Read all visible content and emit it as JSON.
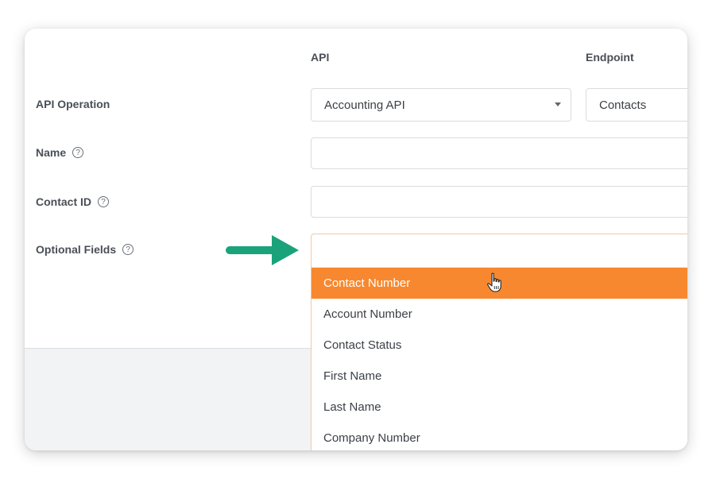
{
  "columns": {
    "api": "API",
    "endpoint": "Endpoint"
  },
  "rows": {
    "api_operation": {
      "label": "API Operation",
      "api_value": "Accounting API",
      "endpoint_value": "Contacts"
    },
    "name": {
      "label": "Name",
      "value": ""
    },
    "contact_id": {
      "label": "Contact ID",
      "value": ""
    },
    "optional_fields": {
      "label": "Optional Fields",
      "value": ""
    }
  },
  "help_glyph": "?",
  "dropdown": {
    "options": [
      "Contact Number",
      "Account Number",
      "Contact Status",
      "First Name",
      "Last Name",
      "Company Number"
    ],
    "highlighted": "Contact Number"
  },
  "colors": {
    "accent": "#f7882f",
    "arrow": "#1aa37a",
    "label": "#4a4f57"
  }
}
